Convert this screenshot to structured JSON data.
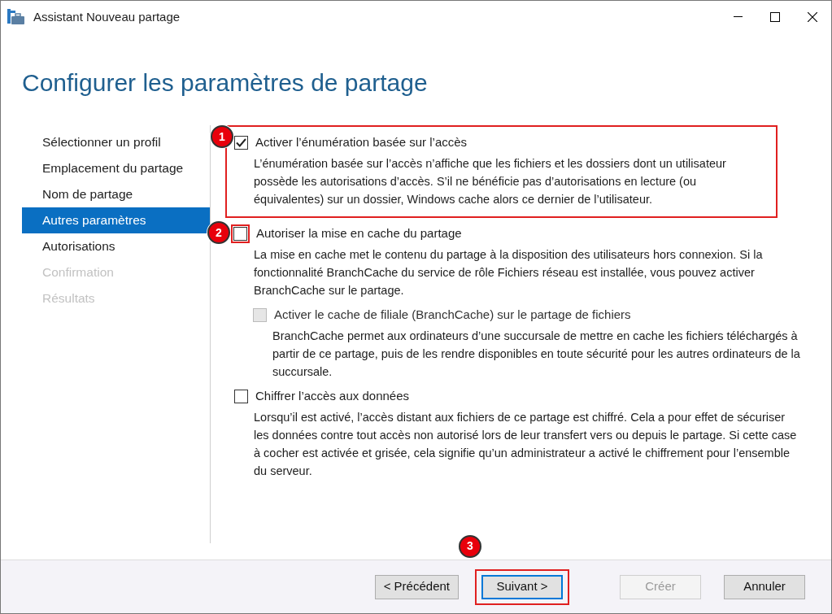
{
  "window": {
    "title": "Assistant Nouveau partage"
  },
  "heading": "Configurer les paramètres de partage",
  "sidebar": {
    "items": [
      {
        "label": "Sélectionner un profil",
        "selected": false,
        "disabled": false
      },
      {
        "label": "Emplacement du partage",
        "selected": false,
        "disabled": false
      },
      {
        "label": "Nom de partage",
        "selected": false,
        "disabled": false
      },
      {
        "label": "Autres paramètres",
        "selected": true,
        "disabled": false
      },
      {
        "label": "Autorisations",
        "selected": false,
        "disabled": false
      },
      {
        "label": "Confirmation",
        "selected": false,
        "disabled": true
      },
      {
        "label": "Résultats",
        "selected": false,
        "disabled": true
      }
    ]
  },
  "options": [
    {
      "label": "Activer l’énumération basée sur l’accès",
      "checked": true,
      "disabled": false,
      "marker": "1",
      "highlighted": true,
      "description": "L’énumération basée sur l’accès n’affiche que les fichiers et les dossiers dont un utilisateur possède les autorisations d’accès. S’il ne bénéficie pas d’autorisations en lecture (ou équivalentes) sur un dossier, Windows cache alors ce dernier de l’utilisateur."
    },
    {
      "label": "Autoriser la mise en cache du partage",
      "checked": false,
      "disabled": false,
      "marker": "2",
      "checkbox_highlighted": true,
      "description": "La mise en cache met le contenu du partage à la disposition des utilisateurs hors connexion. Si la fonctionnalité BranchCache du service de rôle Fichiers réseau est installée, vous pouvez activer BranchCache sur le partage.",
      "children": [
        {
          "label": "Activer le cache de filiale (BranchCache) sur le partage de fichiers",
          "checked": false,
          "disabled": true,
          "description": "BranchCache permet aux ordinateurs d’une succursale de mettre en cache les fichiers téléchargés à partir de ce partage, puis de les rendre disponibles en toute sécurité pour les autres ordinateurs de la succursale."
        }
      ]
    },
    {
      "label": "Chiffrer l’accès aux données",
      "checked": false,
      "disabled": false,
      "description": "Lorsqu’il est activé, l’accès distant aux fichiers de ce partage est chiffré. Cela a pour effet de sécuriser les données contre tout accès non autorisé lors de leur transfert vers ou depuis le partage. Si cette case à cocher est activée et grisée, cela signifie qu’un administrateur a activé le chiffrement pour l’ensemble du serveur."
    }
  ],
  "buttons": [
    {
      "label": "< Précédent",
      "disabled": false,
      "focused": false,
      "highlighted": false
    },
    {
      "label": "Suivant >",
      "disabled": false,
      "focused": true,
      "highlighted": true,
      "marker": "3"
    },
    {
      "label": "Créer",
      "disabled": true,
      "focused": false,
      "highlighted": false
    },
    {
      "label": "Annuler",
      "disabled": false,
      "focused": false,
      "highlighted": false
    }
  ]
}
